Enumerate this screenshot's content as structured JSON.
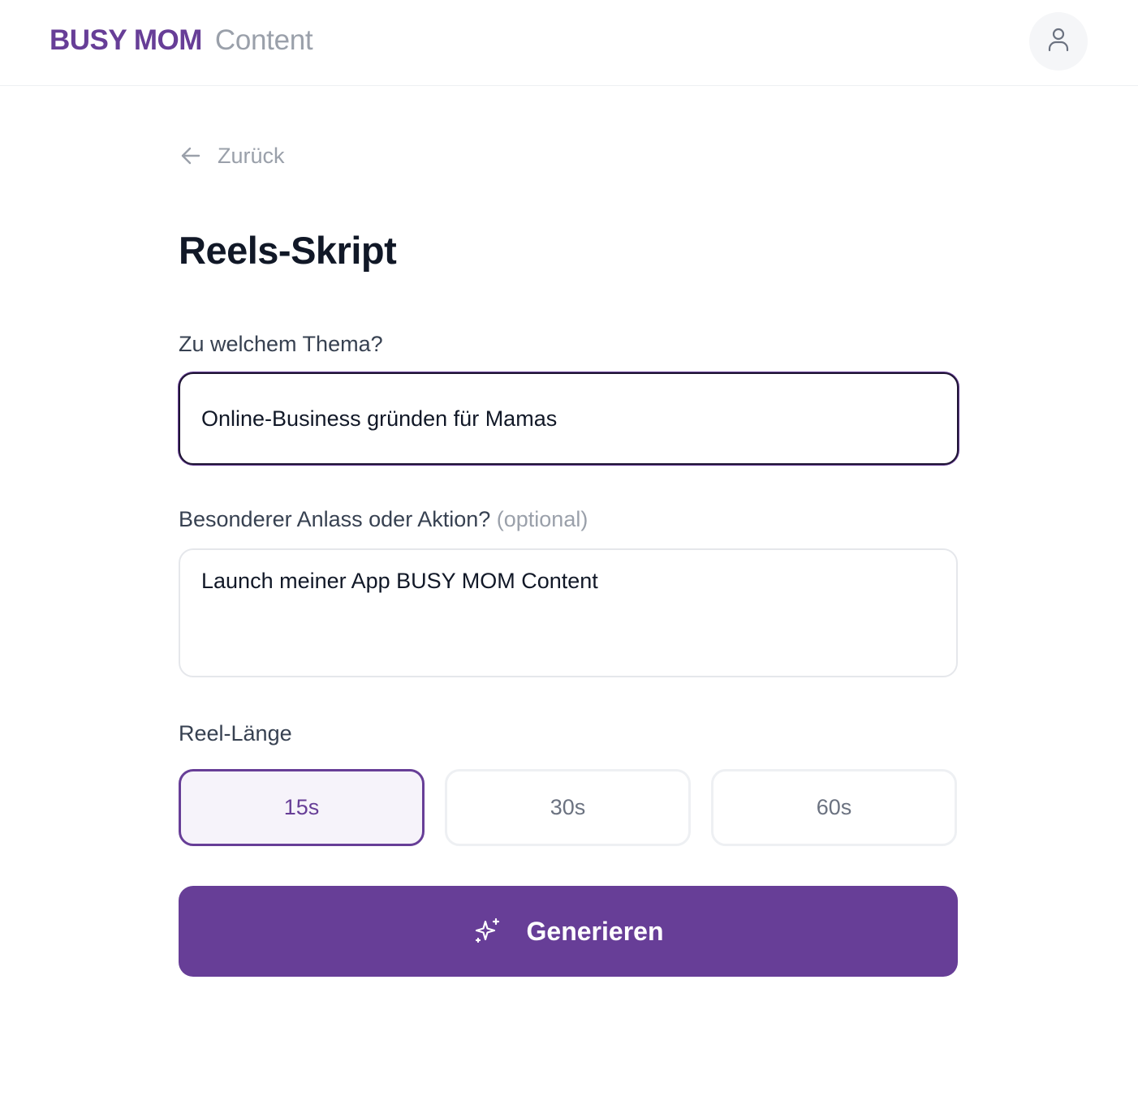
{
  "header": {
    "brand_main": "BUSY MOM",
    "brand_sub": "Content",
    "profile_icon": "user-icon"
  },
  "nav": {
    "back_label": "Zurück",
    "back_icon": "arrow-left-icon"
  },
  "page": {
    "title": "Reels-Skript"
  },
  "form": {
    "topic": {
      "label": "Zu welchem Thema?",
      "value": "Online-Business gründen für Mamas"
    },
    "occasion": {
      "label": "Besonderer Anlass oder Aktion?",
      "optional_label": "(optional)",
      "value": "Launch meiner App BUSY MOM Content"
    },
    "length": {
      "label": "Reel-Länge",
      "options": [
        "15s",
        "30s",
        "60s"
      ],
      "selected": "15s"
    },
    "generate": {
      "label": "Generieren",
      "icon": "sparkles-icon"
    }
  },
  "colors": {
    "brand": "#673e97",
    "muted_text": "#9aa0aa",
    "selected_bg": "#f6f3fa"
  }
}
